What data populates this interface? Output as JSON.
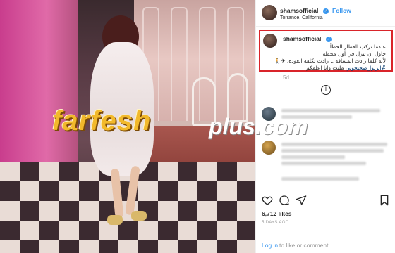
{
  "post": {
    "username": "shamsofficial_",
    "separator": "•",
    "follow_label": "Follow",
    "location": "Torrance, California"
  },
  "caption": {
    "username": "shamsofficial_",
    "lines": [
      "عندما تركب القطار الخطأ",
      "حاول أن تنزل في أول محطة",
      "لأنه كلما زادت المسافة .. زادت تكلفة العودة. ✈🚶",
      "مليت وانا اعلمكم"
    ],
    "hashtag": "#انزلوا_صحيحوني",
    "time_ago": "5d"
  },
  "watermark": {
    "main": "farfesh",
    "plus": "plus.com"
  },
  "actions": {
    "likes": "6,712 likes",
    "date": "5 DAYS AGO"
  },
  "footer": {
    "login": "Log in",
    "to_like": "to like or comment."
  },
  "colors": {
    "accent": "#3897f0",
    "highlight_box": "#d9242a"
  }
}
